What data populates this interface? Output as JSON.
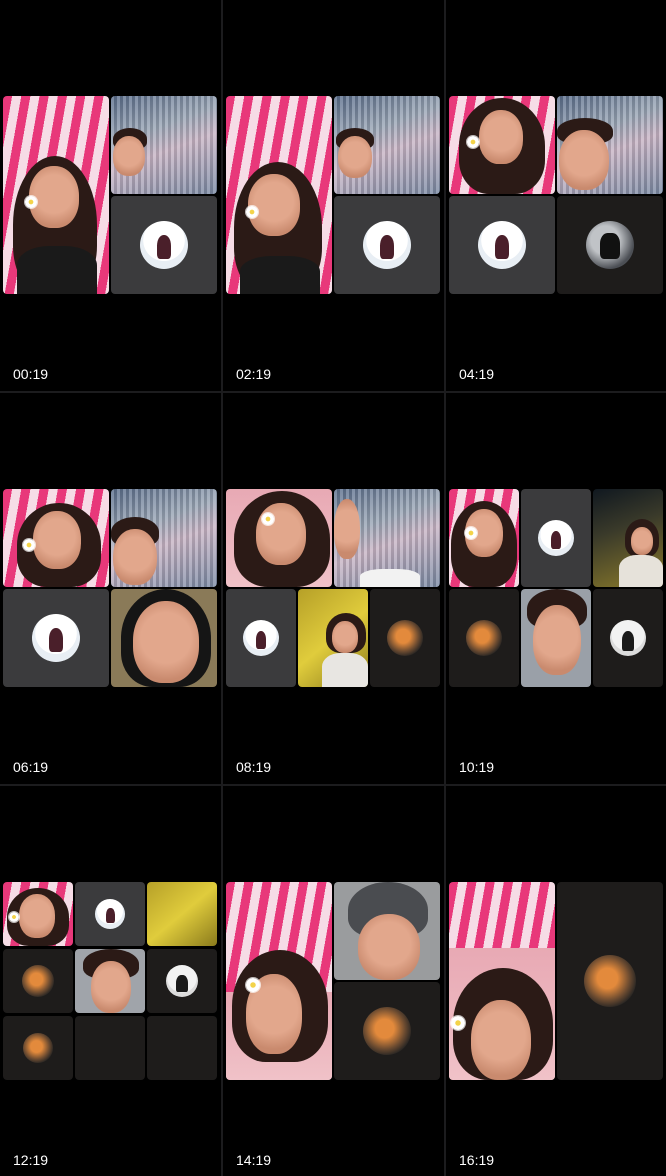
{
  "screen_title": "",
  "timestamps": [
    "00:19",
    "02:19",
    "04:19",
    "06:19",
    "08:19",
    "10:19",
    "12:19",
    "14:19",
    "16:19"
  ],
  "colors": {
    "background": "#000000",
    "tile_dark": "#1e1c1b",
    "tile_camera_off": "#3b3b3d",
    "stripe_pink": "#e8387a",
    "text": "#ffffff"
  }
}
